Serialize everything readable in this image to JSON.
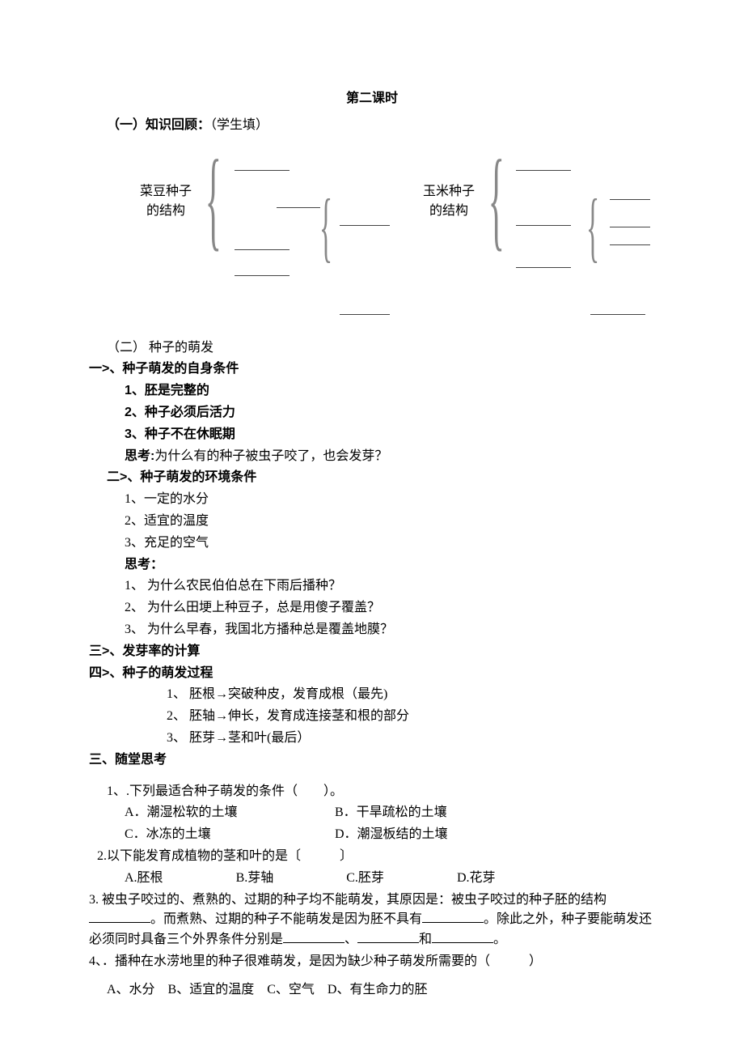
{
  "title": "第二课时",
  "review": {
    "heading": "（一）知识回顾：",
    "note": "（学生填）",
    "left_label1": "菜豆种子",
    "left_label2": "的结构",
    "right_label1": "玉米种子",
    "right_label2": "的结构"
  },
  "section2": {
    "heading": "（二） 种子的萌发",
    "sub1": {
      "heading": "一>、种子萌发的自身条件",
      "items": {
        "i1": "1、胚是完整的",
        "i2": "2、种子必须后活力",
        "i3": "3、种子不在休眠期"
      },
      "think_label": "思考:",
      "think_text": "为什么有的种子被虫子咬了，也会发芽？"
    },
    "sub2": {
      "heading": "二>、种子萌发的环境条件",
      "items": {
        "i1": "1、一定的水分",
        "i2": "2、适宜的温度",
        "i3": "3、充足的空气"
      },
      "think_label": "思考：",
      "think_items": {
        "q1": "1、 为什么农民伯伯总在下雨后播种？",
        "q2": "2、 为什么田埂上种豆子，总是用傻子覆盖？",
        "q3": "3、 为什么早春，我国北方播种总是覆盖地膜？"
      }
    },
    "sub3": "三>、发芽率的计算",
    "sub4": {
      "heading": "四>、种子的萌发过程",
      "items": {
        "i1": "1、 胚根→突破种皮，发育成根（最先)",
        "i2": "2、 胚轴→伸长，发育成连接茎和根的部分",
        "i3": "3、 胚芽→茎和叶(最后）"
      }
    }
  },
  "section3": {
    "heading": "三、随堂思考",
    "q1": {
      "stem": "1、.下列最适合种子萌发的条件（　　）。",
      "A": "A．潮湿松软的土壤",
      "B": "B．干旱疏松的土壤",
      "C": "C．冰冻的土壤",
      "D": "D．潮湿板结的土壤"
    },
    "q2": {
      "stem": "2.以下能发育成植物的茎和叶的是〔　　　〕",
      "A": "A.胚根",
      "B": "B.芽轴",
      "C": "C.胚芽",
      "D": "D.花芽"
    },
    "q3": {
      "part1": "3. 被虫子咬过的、煮熟的、过期的种子均不能萌发，其原因是：被虫子咬过的种子胚的结构",
      "part2": "。而煮熟、过期的种子不能萌发是因为胚不具有",
      "part3": "。除此之外，种子要能萌发还必须同时具备三个外界条件分别是",
      "sep1": "、",
      "sep2": "和",
      "part4": "。"
    },
    "q4": {
      "stem": "4、．播种在水涝地里的种子很难萌发，是因为缺少种子萌发所需要的（　　　）",
      "opts": "A、水分　B、适宜的温度　C、空气　D、有生命力的胚"
    }
  }
}
